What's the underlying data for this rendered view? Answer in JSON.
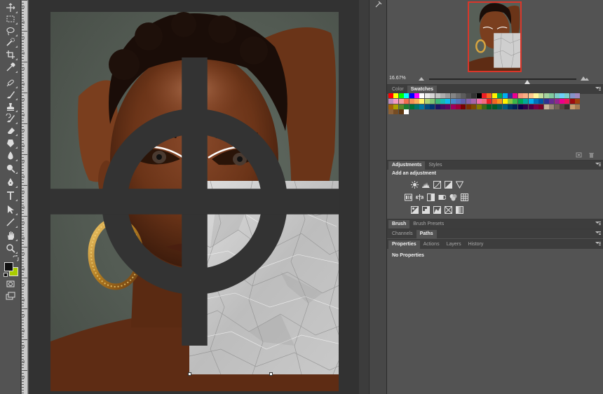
{
  "tools": [
    {
      "name": "move-tool-icon"
    },
    {
      "name": "marquee-tool-icon"
    },
    {
      "name": "lasso-tool-icon"
    },
    {
      "name": "quick-select-tool-icon"
    },
    {
      "name": "crop-tool-icon"
    },
    {
      "name": "eyedropper-tool-icon"
    },
    {
      "name": "healing-brush-tool-icon"
    },
    {
      "name": "brush-tool-icon"
    },
    {
      "name": "clone-stamp-tool-icon"
    },
    {
      "name": "history-brush-tool-icon"
    },
    {
      "name": "eraser-tool-icon"
    },
    {
      "name": "gradient-tool-icon"
    },
    {
      "name": "blur-tool-icon"
    },
    {
      "name": "dodge-tool-icon"
    },
    {
      "name": "pen-tool-icon"
    },
    {
      "name": "type-tool-icon"
    },
    {
      "name": "path-selection-tool-icon"
    },
    {
      "name": "line-tool-icon"
    },
    {
      "name": "hand-tool-icon"
    },
    {
      "name": "zoom-tool-icon"
    }
  ],
  "colors": {
    "foreground": "#111111",
    "background": "#aacc00",
    "navigator_frame": "#d9362a"
  },
  "ruler": {
    "labels": [
      "0",
      "0",
      "0",
      "0",
      "0",
      "0",
      "0",
      "0",
      "0",
      "0",
      "0",
      "0",
      "0",
      "0",
      "0",
      "0",
      "0",
      "0",
      "0",
      "0",
      "0",
      "0",
      "0",
      "0",
      "0"
    ]
  },
  "navigator": {
    "zoom": "16.67%"
  },
  "color_panel": {
    "tabs": [
      "Color",
      "Swatches"
    ],
    "active_tab": "Swatches",
    "swatches": [
      "#ff0000",
      "#ffff00",
      "#00ff00",
      "#00ffff",
      "#0000ff",
      "#ff00ff",
      "#ffffff",
      "#ebebeb",
      "#d6d6d6",
      "#c2c2c2",
      "#adadad",
      "#999999",
      "#858585",
      "#707070",
      "#5c5c5c",
      "#474747",
      "#333333",
      "#000000",
      "#ee1d24",
      "#f26522",
      "#fff200",
      "#00a651",
      "#00aeef",
      "#2e3192",
      "#ec008c",
      "#f7977a",
      "#fbad82",
      "#fdc68c",
      "#fff799",
      "#c6df9c",
      "#a4d49d",
      "#81ca9d",
      "#7bcdc8",
      "#6ccff7",
      "#7accc8",
      "#8493ca",
      "#a187be",
      "#bc8cbf",
      "#f49ac1",
      "#f5989d",
      "#f16c4d",
      "#f68e55",
      "#fbaf5a",
      "#fff467",
      "#acd372",
      "#7dc473",
      "#39b778",
      "#16bcb4",
      "#0ebaef",
      "#438cca",
      "#5574b9",
      "#605ca9",
      "#8560a8",
      "#a864a8",
      "#f06ea9",
      "#f26d7d",
      "#ed1c24",
      "#f26522",
      "#f7941d",
      "#fff200",
      "#8dc63f",
      "#39b54a",
      "#00a651",
      "#00a99d",
      "#00aeef",
      "#0072bc",
      "#0054a6",
      "#2e3192",
      "#662d91",
      "#92278f",
      "#ec008c",
      "#ed145b",
      "#9e0b0f",
      "#a0410d",
      "#a3620a",
      "#aba000",
      "#598527",
      "#1a7b30",
      "#007236",
      "#00746b",
      "#0076a3",
      "#004b80",
      "#003471",
      "#1b1464",
      "#440e62",
      "#630460",
      "#9e005d",
      "#9e0039",
      "#790000",
      "#7b2e00",
      "#7d4900",
      "#827b00",
      "#406618",
      "#005e20",
      "#005826",
      "#005952",
      "#005b7f",
      "#003663",
      "#002157",
      "#0d004c",
      "#32004b",
      "#4b0049",
      "#7b0046",
      "#7a0026",
      "#c7b299",
      "#998675",
      "#736357",
      "#534741",
      "#37302d",
      "#c69c6d",
      "#a67c52",
      "#8c6239",
      "#754c24",
      "#603913",
      "#ffffff"
    ]
  },
  "adjustments_panel": {
    "tabs": [
      "Adjustments",
      "Styles"
    ],
    "active_tab": "Adjustments",
    "title": "Add an adjustment",
    "icons": [
      "brightness-contrast-icon",
      "levels-icon",
      "curves-icon",
      "exposure-icon",
      "vibrance-icon",
      "hue-saturation-icon",
      "color-balance-icon",
      "black-white-icon",
      "photo-filter-icon",
      "channel-mixer-icon",
      "color-lookup-icon",
      "invert-icon",
      "posterize-icon",
      "threshold-icon",
      "selective-color-icon",
      "gradient-map-icon"
    ]
  },
  "brush_panel": {
    "tabs": [
      "Brush",
      "Brush Presets"
    ],
    "active_tab": "Brush"
  },
  "paths_panel": {
    "tabs": [
      "Channels",
      "Paths"
    ],
    "active_tab": "Paths"
  },
  "properties_panel": {
    "tabs": [
      "Properties",
      "Actions",
      "Layers",
      "History"
    ],
    "active_tab": "Properties",
    "message": "No Properties"
  }
}
